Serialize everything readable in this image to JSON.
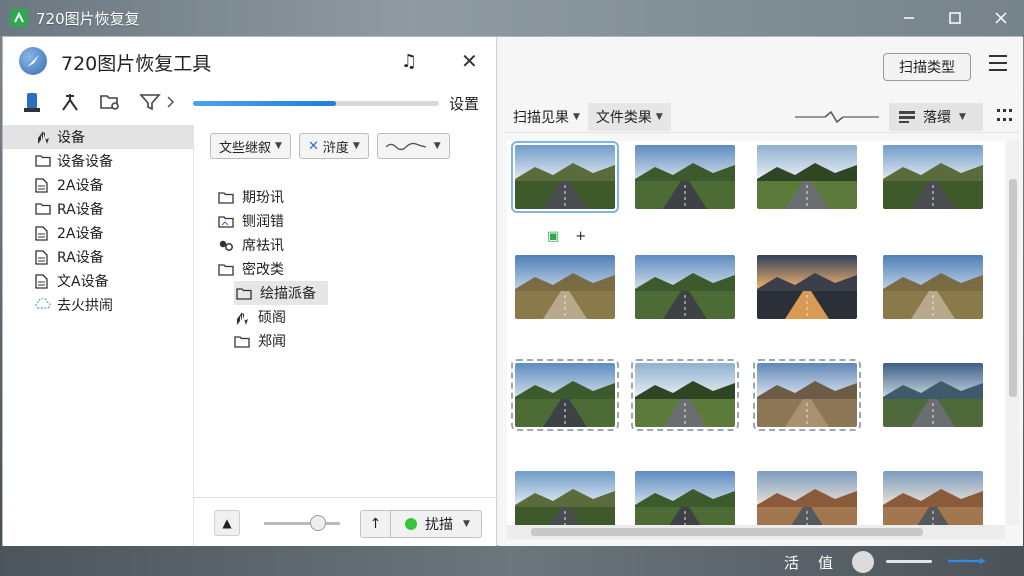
{
  "window": {
    "title": "720图片恢复复"
  },
  "app": {
    "name": "720图片恢复工具",
    "settings_label": "设置",
    "progress": 0.58
  },
  "tree": {
    "items": [
      {
        "label": "设备",
        "icon": "hand-icon",
        "selected": true
      },
      {
        "label": "设备设备",
        "icon": "folder-icon"
      },
      {
        "label": "2A设备",
        "icon": "doc-icon"
      },
      {
        "label": "RA设备",
        "icon": "folder-icon"
      },
      {
        "label": "2A设备",
        "icon": "doc-icon"
      },
      {
        "label": "RA设备",
        "icon": "doc-icon"
      },
      {
        "label": "文A设备",
        "icon": "doc-icon"
      },
      {
        "label": "去火拱闹",
        "icon": "cloud-icon"
      }
    ]
  },
  "filters": {
    "type_label": "文些继叙",
    "depth_label": "浒度",
    "wave_label": ""
  },
  "folders": {
    "items": [
      {
        "label": "期玢讯",
        "icon": "folder-icon"
      },
      {
        "label": "铡润错",
        "icon": "image-folder-icon"
      },
      {
        "label": "席袪讯",
        "icon": "people-icon"
      },
      {
        "label": "密改类",
        "icon": "folder-icon"
      },
      {
        "label": "绘描派备",
        "icon": "folder-icon",
        "indent": true,
        "selected": true
      },
      {
        "label": "硕阁",
        "icon": "hand-icon",
        "indent": true
      },
      {
        "label": "郑闻",
        "icon": "folder-icon",
        "indent": true
      }
    ]
  },
  "footer": {
    "scan_label": "扰描"
  },
  "right": {
    "scan_type_label": "扫描类型",
    "tabs": [
      {
        "label": "扫描见果",
        "active": false
      },
      {
        "label": "文件类果",
        "active": true
      }
    ],
    "sort_label": "落缳"
  },
  "thumbnails": [
    {
      "variant": "road-green",
      "state": "selected"
    },
    {
      "variant": "road-trees",
      "state": "normal"
    },
    {
      "variant": "forest-road",
      "state": "normal"
    },
    {
      "variant": "road-green",
      "state": "normal"
    },
    {
      "variant": "field-path",
      "state": "normal"
    },
    {
      "variant": "road-trees",
      "state": "normal"
    },
    {
      "variant": "sunset-lake",
      "state": "normal"
    },
    {
      "variant": "field-path",
      "state": "normal"
    },
    {
      "variant": "road-trees",
      "state": "dashed"
    },
    {
      "variant": "forest-road",
      "state": "dashed"
    },
    {
      "variant": "rocky-path",
      "state": "dashed"
    },
    {
      "variant": "lake-road",
      "state": "normal"
    },
    {
      "variant": "road-green",
      "state": "normal"
    },
    {
      "variant": "road-trees",
      "state": "normal"
    },
    {
      "variant": "desert-road",
      "state": "normal"
    },
    {
      "variant": "desert-road",
      "state": "normal"
    }
  ],
  "status": {
    "text_a": "活",
    "text_b": "值"
  },
  "colors": {
    "accent": "#1d7fe0",
    "scan_dot": "#37c43b"
  }
}
